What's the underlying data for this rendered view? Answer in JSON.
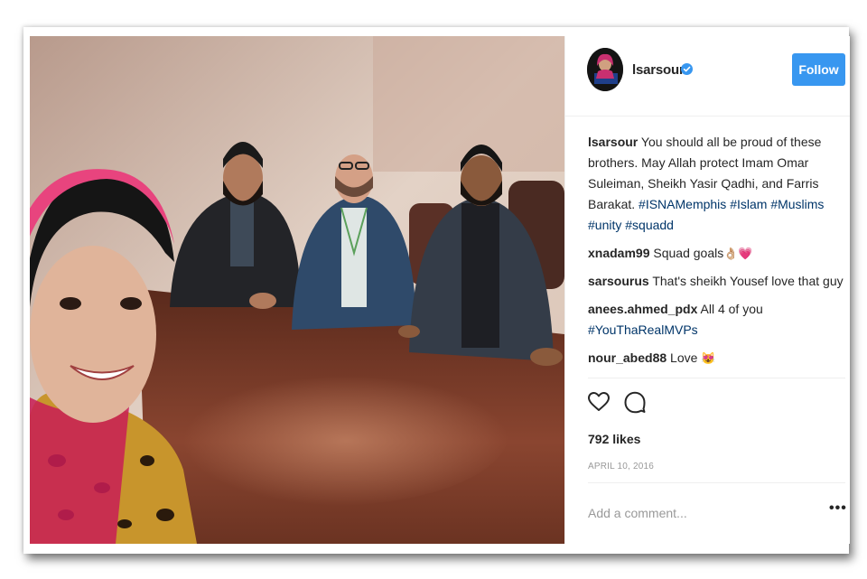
{
  "post": {
    "username": "lsarsour",
    "follow_label": "Follow",
    "caption": {
      "user": "lsarsour",
      "text": "You should all be proud of these brothers. May Allah protect Imam Omar Suleiman, Sheikh Yasir Qadhi, and Farris Barakat.",
      "hashtags": [
        "#ISNAMemphis",
        "#Islam",
        "#Muslims",
        "#unity",
        "#squadd"
      ]
    },
    "comments": [
      {
        "user": "xnadam99",
        "text": "Squad goals",
        "emoji": "👌🏼💗"
      },
      {
        "user": "sarsourus",
        "text": "That's sheikh Yousef love that guy"
      },
      {
        "user": "anees.ahmed_pdx",
        "text": "All 4 of you",
        "hashtag": "#YouThaRealMVPs"
      },
      {
        "user": "nour_abed88",
        "text": "Love",
        "emoji": "😻"
      }
    ],
    "likes": "792 likes",
    "date": "APRIL 10, 2016",
    "comment_placeholder": "Add a comment...",
    "more_label": "•••"
  },
  "colors": {
    "accent": "#3897f0",
    "hashtag": "#003569",
    "muted": "#999999",
    "text": "#262626"
  },
  "icons": {
    "verified": "verified-badge-icon",
    "like": "heart-icon",
    "comment": "comment-bubble-icon",
    "more": "more-options-icon"
  }
}
